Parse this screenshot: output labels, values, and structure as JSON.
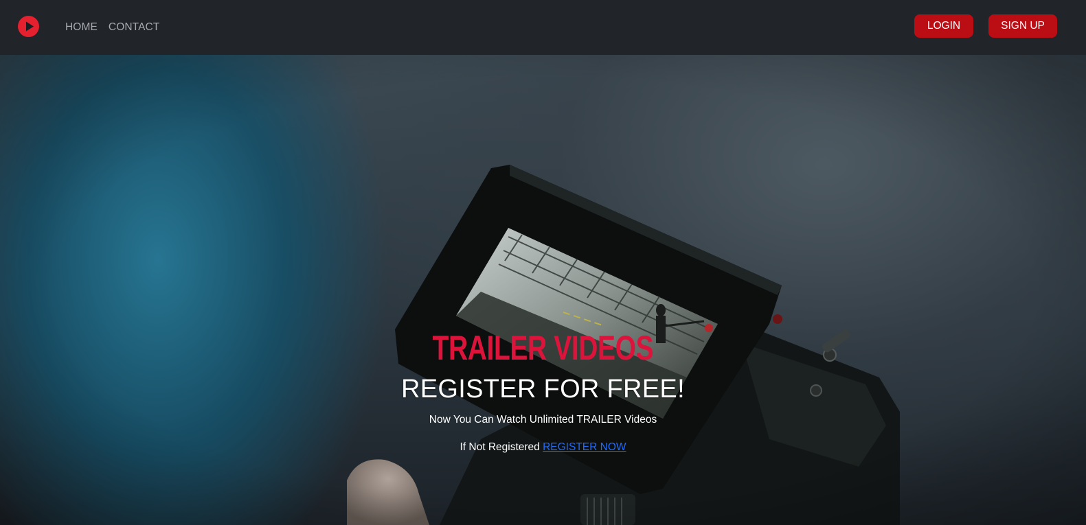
{
  "nav": {
    "logo_icon": "play-circle-icon",
    "links": [
      {
        "label": "HOME"
      },
      {
        "label": "CONTACT"
      }
    ],
    "login_label": "LOGIN",
    "signup_label": "SIGN UP"
  },
  "hero": {
    "title": "TRAILER VIDEOS",
    "subtitle": "REGISTER FOR FREE!",
    "description": "Now You Can Watch Unlimited TRAILER Videos",
    "register_prefix": "If Not Registered",
    "register_link": "REGISTER NOW",
    "background_image": "camera-monitor-photo"
  },
  "colors": {
    "navbar_bg": "#212429",
    "accent": "#bb0d14",
    "logo": "#e5202f",
    "title": "#dc143c",
    "link": "#1e6bff"
  }
}
